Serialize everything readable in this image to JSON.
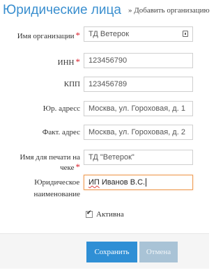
{
  "header": {
    "title": "Юридические лица",
    "breadcrumb": "» Добавить организацию"
  },
  "form": {
    "org_name": {
      "label": "Имя организации",
      "required_mark": "*",
      "value": "ТД Ветерок"
    },
    "inn": {
      "label": "ИНН",
      "required_mark": "*",
      "value": "123456790"
    },
    "kpp": {
      "label": "КПП",
      "value": "123456789"
    },
    "legal_address": {
      "label": "Юр. адресс",
      "value": "Москва, ул. Гороховая, д. 1"
    },
    "actual_address": {
      "label": "Факт. адрес",
      "value": "Москва, ул. Гороховая, д. 2"
    },
    "receipt_name": {
      "label": "Имя для печати на чеке",
      "required_mark": "*",
      "value": "ТД \"Ветерок\""
    },
    "legal_name": {
      "label_line1": "Юридическое",
      "label_line2": "наименование",
      "value_prefix": "ИП",
      "value_rest": " Иванов В.С."
    },
    "active": {
      "label": "Активна",
      "checked": true
    }
  },
  "buttons": {
    "save": "Сохранить",
    "cancel": "Отмена"
  },
  "colors": {
    "title": "#3a8fcf",
    "required": "#d9232e",
    "primary_button": "#2f8fd5",
    "cancel_button": "#a9c3d6",
    "focus_border": "#f0a05a"
  }
}
